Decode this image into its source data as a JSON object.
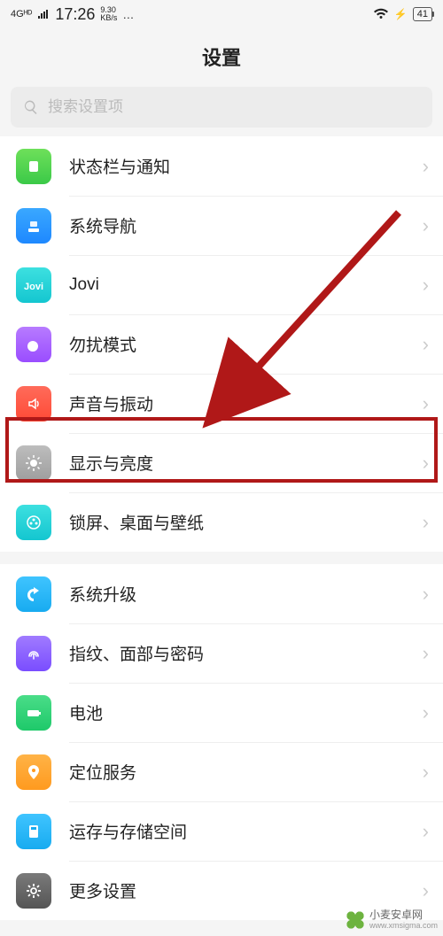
{
  "status": {
    "network": "4Gᴴᴰ",
    "time": "17:26",
    "speed_top": "9.30",
    "speed_bot": "KB/s",
    "dots": "…",
    "battery": "41"
  },
  "header": {
    "title": "设置"
  },
  "search": {
    "placeholder": "搜索设置项"
  },
  "groups": [
    {
      "items": [
        {
          "id": "notif",
          "label": "状态栏与通知",
          "iconClass": "ic-green",
          "iconName": "notification-icon"
        },
        {
          "id": "nav",
          "label": "系统导航",
          "iconClass": "ic-blue",
          "iconName": "navigation-icon"
        },
        {
          "id": "jovi",
          "label": "Jovi",
          "iconClass": "ic-teal",
          "iconName": "jovi-icon"
        },
        {
          "id": "dnd",
          "label": "勿扰模式",
          "iconClass": "ic-purple",
          "iconName": "dnd-icon"
        },
        {
          "id": "sound",
          "label": "声音与振动",
          "iconClass": "ic-red",
          "iconName": "sound-icon"
        },
        {
          "id": "display",
          "label": "显示与亮度",
          "iconClass": "ic-gray",
          "iconName": "brightness-icon",
          "highlighted": true
        },
        {
          "id": "lock",
          "label": "锁屏、桌面与壁纸",
          "iconClass": "ic-teal",
          "iconName": "wallpaper-icon"
        }
      ]
    },
    {
      "items": [
        {
          "id": "update",
          "label": "系统升级",
          "iconClass": "ic-cyan",
          "iconName": "update-icon"
        },
        {
          "id": "biometric",
          "label": "指纹、面部与密码",
          "iconClass": "ic-pviolet",
          "iconName": "fingerprint-icon"
        },
        {
          "id": "battery",
          "label": "电池",
          "iconClass": "ic-sgreen",
          "iconName": "battery-icon"
        },
        {
          "id": "location",
          "label": "定位服务",
          "iconClass": "ic-orange",
          "iconName": "location-icon"
        },
        {
          "id": "storage",
          "label": "运存与存储空间",
          "iconClass": "ic-cyan",
          "iconName": "storage-icon"
        },
        {
          "id": "more",
          "label": "更多设置",
          "iconClass": "ic-dark",
          "iconName": "gear-icon"
        }
      ]
    }
  ],
  "watermark": {
    "name": "小麦安卓网",
    "url": "www.xmsigma.com"
  }
}
